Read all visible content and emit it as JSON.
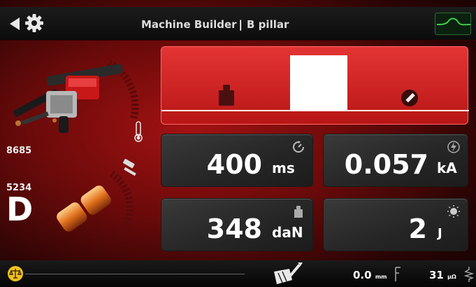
{
  "header": {
    "title_left": "Machine Builder",
    "separator": "|",
    "title_right": "B pillar"
  },
  "left_panel": {
    "code_top": "8685",
    "code_bottom": "5234",
    "letter": "D"
  },
  "tiles": {
    "time": {
      "value": "400",
      "unit": "ms",
      "icon": "timer-icon"
    },
    "current": {
      "value": "0.057",
      "unit": "kA",
      "icon": "lightning-icon"
    },
    "force": {
      "value": "348",
      "unit": "daN",
      "icon": "weight-icon"
    },
    "energy": {
      "value": "2",
      "unit": "J",
      "icon": "sun-icon"
    }
  },
  "footer": {
    "distance_value": "0.0",
    "distance_unit": "mm",
    "resistance_value": "31",
    "resistance_unit": "µΩ"
  },
  "colors": {
    "accent_red": "#d42424",
    "panel_dark": "#2c2c2c",
    "wave_green": "#3cd04a",
    "balance_yellow": "#f0c020"
  }
}
